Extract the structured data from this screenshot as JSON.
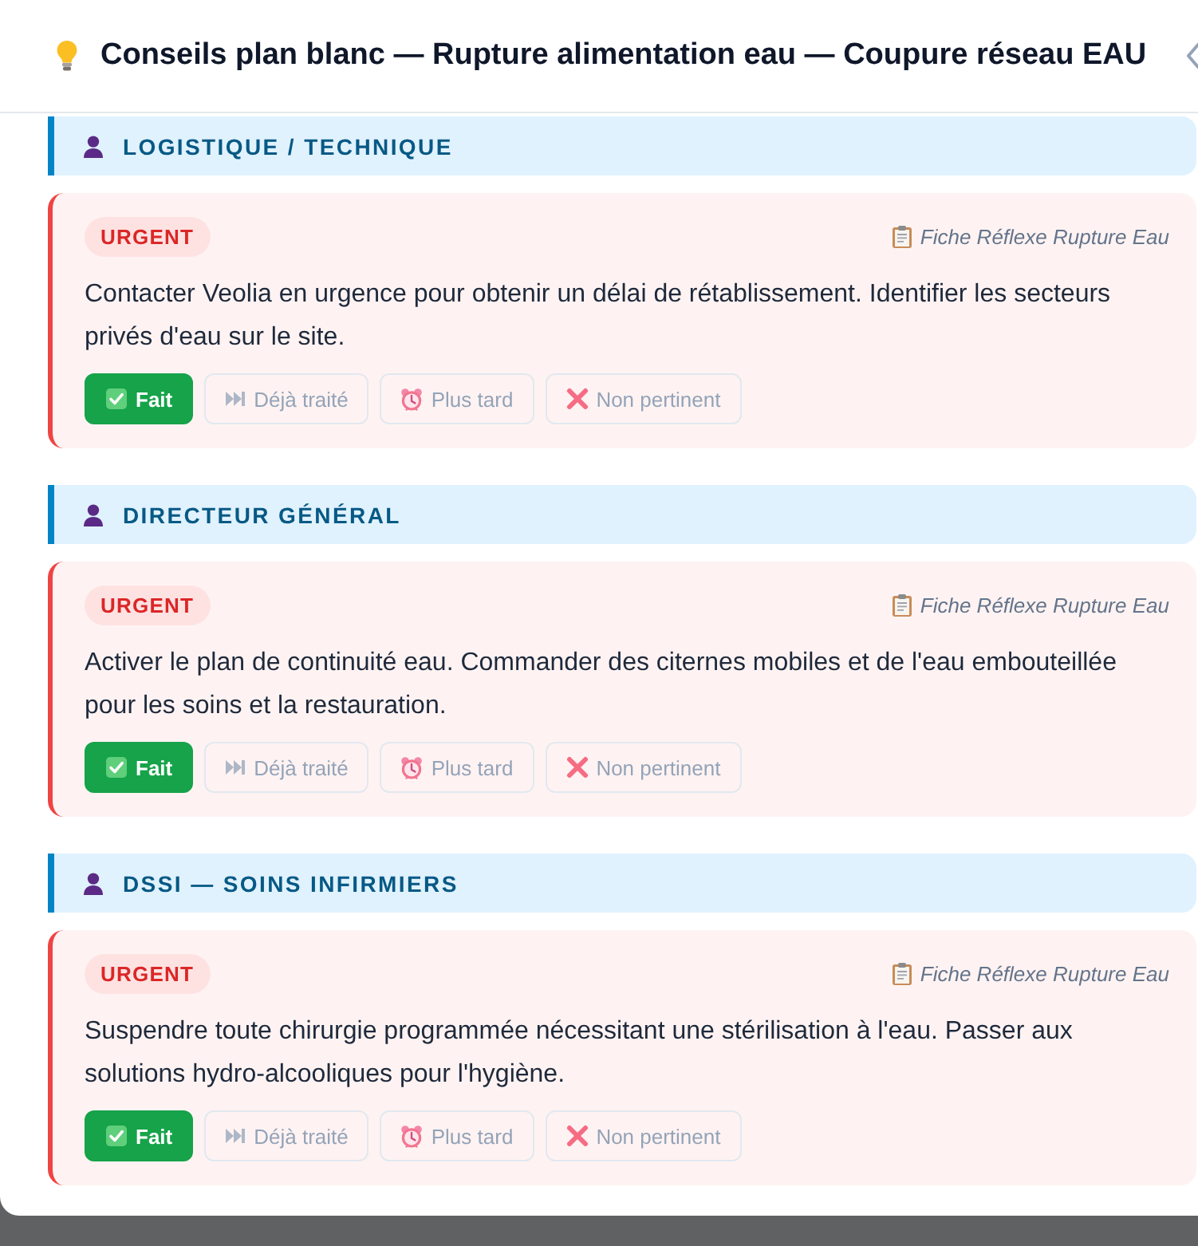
{
  "modal": {
    "title": "Conseils plan blanc — Rupture alimentation eau — Coupure réseau EAU"
  },
  "sections": [
    {
      "role": "LOGISTIQUE / TECHNIQUE",
      "advices": [
        {
          "kind": "urgent",
          "priority": "URGENT",
          "source": "Fiche Réflexe Rupture Eau",
          "text": "Contacter Veolia en urgence pour obtenir un délai de rétablissement. Identifier les secteurs privés d'eau sur le site.",
          "actions": [
            {
              "kind": "done",
              "label": "Fait",
              "selected": true
            },
            {
              "kind": "skip",
              "label": "Déjà traité",
              "selected": false
            },
            {
              "kind": "later",
              "label": "Plus tard",
              "selected": false
            },
            {
              "kind": "dismiss",
              "label": "Non pertinent",
              "selected": false
            }
          ]
        }
      ]
    },
    {
      "role": "DIRECTEUR GÉNÉRAL",
      "advices": [
        {
          "kind": "urgent",
          "priority": "URGENT",
          "source": "Fiche Réflexe Rupture Eau",
          "text": "Activer le plan de continuité eau. Commander des citernes mobiles et de l'eau embouteillée pour les soins et la restauration.",
          "actions": [
            {
              "kind": "done",
              "label": "Fait",
              "selected": true
            },
            {
              "kind": "skip",
              "label": "Déjà traité",
              "selected": false
            },
            {
              "kind": "later",
              "label": "Plus tard",
              "selected": false
            },
            {
              "kind": "dismiss",
              "label": "Non pertinent",
              "selected": false
            }
          ]
        }
      ]
    },
    {
      "role": "DSSI — SOINS INFIRMIERS",
      "advices": [
        {
          "kind": "urgent",
          "priority": "URGENT",
          "source": "Fiche Réflexe Rupture Eau",
          "text": "Suspendre toute chirurgie programmée nécessitant une stérilisation à l'eau. Passer aux solutions hydro-alcooliques pour l'hygiène.",
          "actions": [
            {
              "kind": "done",
              "label": "Fait",
              "selected": true
            },
            {
              "kind": "skip",
              "label": "Déjà traité",
              "selected": false
            },
            {
              "kind": "later",
              "label": "Plus tard",
              "selected": false
            },
            {
              "kind": "dismiss",
              "label": "Non pertinent",
              "selected": false
            }
          ]
        }
      ]
    }
  ]
}
